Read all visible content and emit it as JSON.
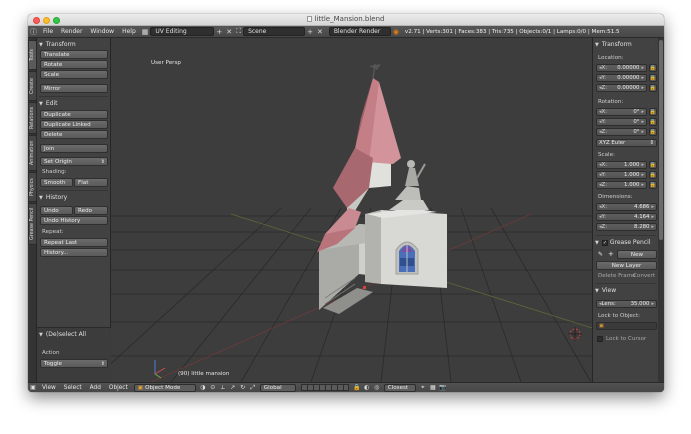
{
  "window": {
    "title": "little_Mansion.blend"
  },
  "menubar": {
    "menus": [
      "File",
      "Render",
      "Window",
      "Help"
    ],
    "layout": "UV Editing",
    "scene": "Scene",
    "engine": "Blender Render",
    "stats": "v2.71 | Verts:301 | Faces:383 | Tris:735 | Objects:0/1 | Lamps:0/0 | Mem:51.5"
  },
  "tabs": [
    "Tools",
    "Create",
    "Relations",
    "Animation",
    "Physics",
    "Grease Pencil"
  ],
  "toolshelf": {
    "transform": {
      "title": "Transform",
      "buttons": [
        "Translate",
        "Rotate",
        "Scale",
        "Mirror"
      ]
    },
    "edit": {
      "title": "Edit",
      "buttons": [
        "Duplicate",
        "Duplicate Linked",
        "Delete",
        "Join",
        "Set Origin"
      ],
      "shading_label": "Shading:",
      "smooth": "Smooth",
      "flat": "Flat"
    },
    "history": {
      "title": "History",
      "undo": "Undo",
      "redo": "Redo",
      "undo_history": "Undo History",
      "repeat_label": "Repeat:",
      "repeat_last": "Repeat Last",
      "history": "History..."
    },
    "operator": {
      "title": "(De)select All",
      "action_label": "Action",
      "action_value": "Toggle"
    }
  },
  "viewport": {
    "view_name": "User Persp",
    "object_name": "(90) little mansion"
  },
  "npanel": {
    "transform_title": "Transform",
    "location_label": "Location:",
    "location": [
      {
        "axis": "X:",
        "value": "0.00000"
      },
      {
        "axis": "Y:",
        "value": "0.00000"
      },
      {
        "axis": "Z:",
        "value": "0.00000"
      }
    ],
    "rotation_label": "Rotation:",
    "rotation": [
      {
        "axis": "X:",
        "value": "0°"
      },
      {
        "axis": "Y:",
        "value": "0°"
      },
      {
        "axis": "Z:",
        "value": "0°"
      }
    ],
    "rotation_mode": "XYZ Euler",
    "scale_label": "Scale:",
    "scale": [
      {
        "axis": "X:",
        "value": "1.000"
      },
      {
        "axis": "Y:",
        "value": "1.000"
      },
      {
        "axis": "Z:",
        "value": "1.000"
      }
    ],
    "dimensions_label": "Dimensions:",
    "dimensions": [
      {
        "axis": "X:",
        "value": "4.686"
      },
      {
        "axis": "Y:",
        "value": "4.164"
      },
      {
        "axis": "Z:",
        "value": "8.280"
      }
    ],
    "grease_title": "Grease Pencil",
    "grease_new": "New",
    "new_layer": "New Layer",
    "delete_frame": "Delete Frame",
    "convert": "Convert",
    "view_title": "View",
    "lens_label": "Lens:",
    "lens_value": "35.000",
    "lock_label": "Lock to Object:",
    "lock_cursor": "Lock to Cursor"
  },
  "statusbar": {
    "menus": [
      "View",
      "Select",
      "Add",
      "Object"
    ],
    "mode": "Object Mode",
    "orientation": "Global",
    "proportional": "Closest"
  },
  "colors": {
    "roof": "#c47f86",
    "wall": "#d3d3cf",
    "glass": "#4a6fb8",
    "grid": "#2c2c2c",
    "viewport_bg": "#3d3d3d"
  }
}
